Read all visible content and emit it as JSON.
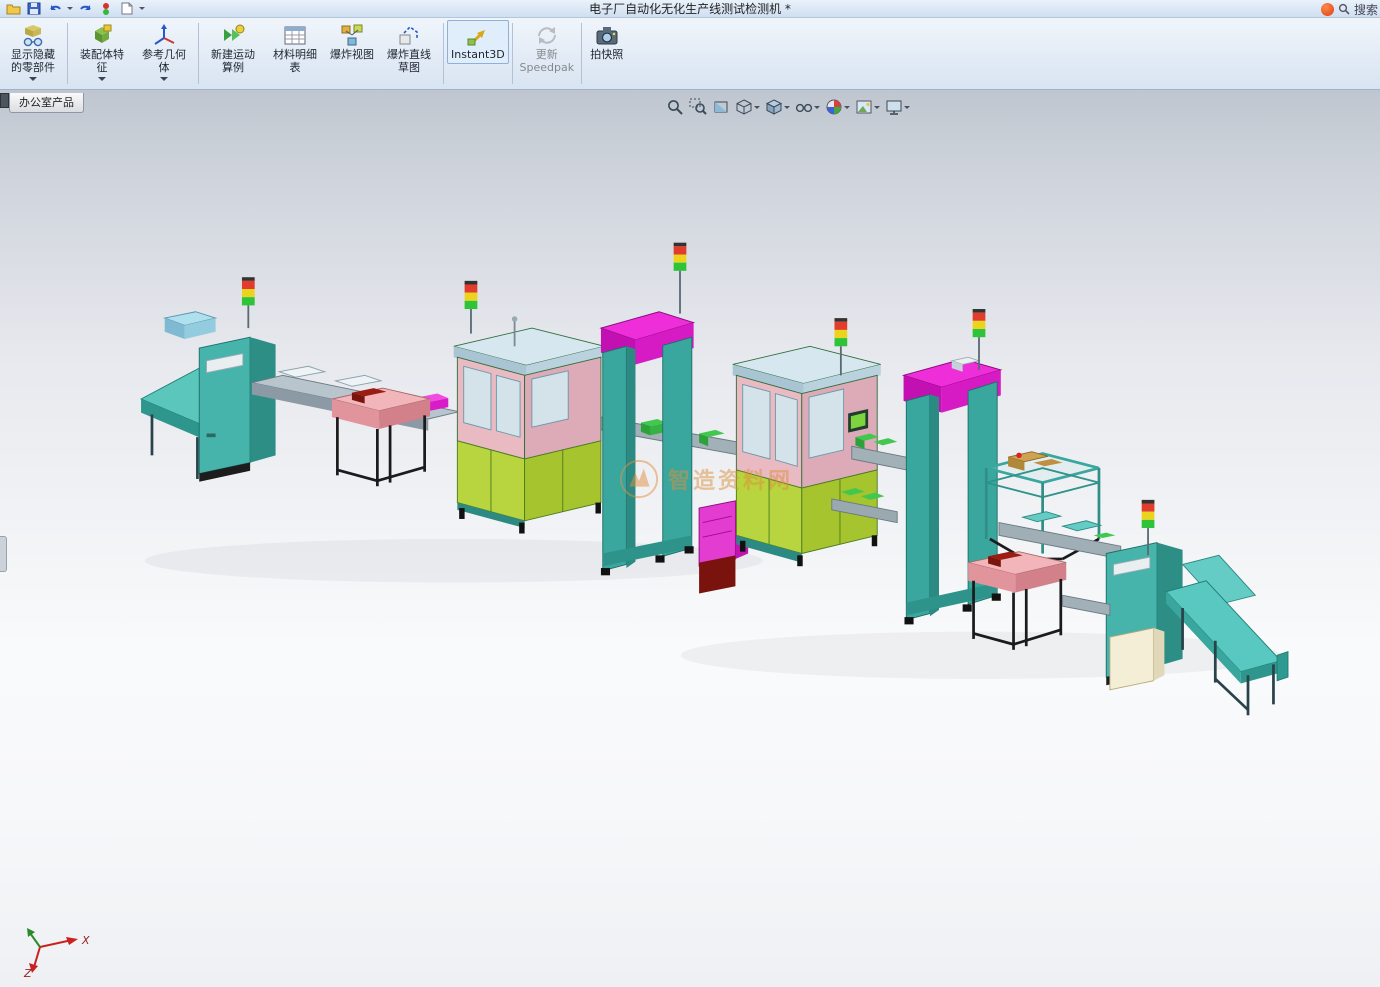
{
  "window": {
    "title": "电子厂自动化无化生产线测试检测机 *",
    "search_label": "搜索"
  },
  "quick_access": {
    "icons": [
      "open-document",
      "save",
      "undo",
      "redo",
      "rebuild",
      "file-properties"
    ]
  },
  "toolbar": {
    "buttons": [
      {
        "label": "显示隐藏的零部件",
        "icon": "show-hidden-components",
        "dropdown": true,
        "disabled": false,
        "active": false
      },
      {
        "label": "装配体特征",
        "icon": "assembly-features",
        "dropdown": true,
        "disabled": false,
        "active": false
      },
      {
        "label": "参考几何体",
        "icon": "reference-geometry",
        "dropdown": true,
        "disabled": false,
        "active": false
      },
      {
        "label": "新建运动算例",
        "icon": "new-motion-study",
        "dropdown": false,
        "disabled": false,
        "active": false
      },
      {
        "label": "材料明细表",
        "icon": "bill-of-materials",
        "dropdown": false,
        "disabled": false,
        "active": false
      },
      {
        "label": "爆炸视图",
        "icon": "exploded-view",
        "dropdown": false,
        "disabled": false,
        "active": false
      },
      {
        "label": "爆炸直线草图",
        "icon": "explode-line-sketch",
        "dropdown": false,
        "disabled": false,
        "active": false
      },
      {
        "label": "Instant3D",
        "icon": "instant3d",
        "dropdown": false,
        "disabled": false,
        "active": true
      },
      {
        "label": "更新Speedpak",
        "icon": "update-speedpak",
        "dropdown": false,
        "disabled": true,
        "active": false
      },
      {
        "label": "拍快照",
        "icon": "snapshot",
        "dropdown": false,
        "disabled": false,
        "active": false
      }
    ]
  },
  "side_tab": {
    "label": "办公室产品"
  },
  "headsup": {
    "icons": [
      "zoom-fit",
      "zoom-area",
      "section-view",
      "view-orientation",
      "display-style",
      "hide-show-items",
      "edit-appearance",
      "apply-scene",
      "view-settings"
    ]
  },
  "viewport": {
    "watermark": "智造资料网",
    "triad": {
      "x": "X",
      "z": "Z"
    }
  },
  "colors": {
    "teal_machine": "#3aa79e",
    "teal_light": "#7bcfc7",
    "magenta_top": "#ee2ed8",
    "lime_doors": "#b8d43e",
    "pink_table": "#f2b6ba",
    "top_slab": "#d6e7ef",
    "signal_red": "#e23c2c",
    "signal_yellow": "#ecd41e",
    "signal_green": "#2ec43a",
    "viewport_top": "#bfc6cf",
    "viewport_bottom": "#eef0f3"
  }
}
